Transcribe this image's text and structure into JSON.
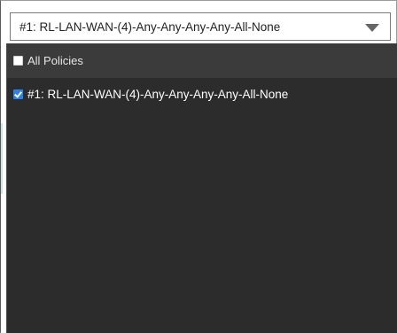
{
  "select": {
    "value": "#1: RL-LAN-WAN-(4)-Any-Any-Any-Any-All-None"
  },
  "panel": {
    "all_policies_label": "All Policies",
    "all_policies_checked": false,
    "options": [
      {
        "label": "#1: RL-LAN-WAN-(4)-Any-Any-Any-Any-All-None",
        "checked": true
      }
    ]
  },
  "colors": {
    "panel_bg": "#2c2c2c",
    "header_bg": "#3b3b3b",
    "checkbox_checked": "#2a83e8"
  },
  "icons": {
    "caret": "chevron-down-icon",
    "checkbox_checked": "check-icon"
  }
}
